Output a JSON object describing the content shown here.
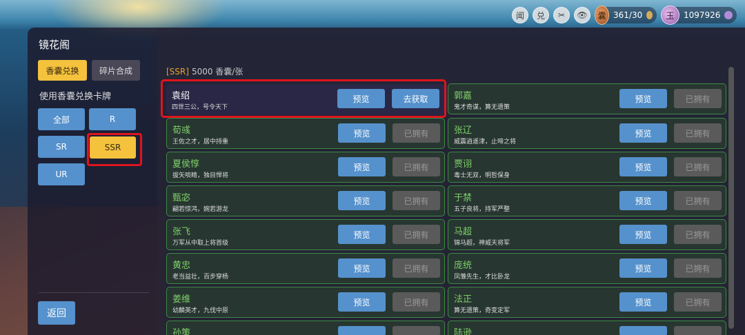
{
  "topbar": {
    "icons": [
      {
        "label": "闻",
        "name": "news-icon"
      },
      {
        "label": "兑",
        "name": "exchange-icon"
      },
      {
        "label": "✂",
        "name": "tool-icon"
      },
      {
        "label": "👁",
        "name": "eye-icon"
      }
    ],
    "currency_bag": "361/30",
    "currency_gem": "1097926"
  },
  "panel": {
    "title": "镜花阁",
    "tabs": [
      "香囊兑换",
      "碎片合成"
    ],
    "active_tab": "香囊兑换",
    "section_label": "使用香囊兑换卡牌",
    "filters": [
      "全部",
      "R",
      "SR",
      "SSR",
      "UR"
    ],
    "active_filter": "SSR",
    "back_label": "返回"
  },
  "content": {
    "rarity_tag": "[SSR]",
    "rarity_cost": "5000 香囊/张",
    "buttons": {
      "preview": "预览",
      "get": "去获取",
      "owned": "已拥有"
    },
    "left_cards": [
      {
        "name": "袁绍",
        "desc": "四世三公，号令天下",
        "status": "get"
      },
      {
        "name": "荀彧",
        "desc": "王佐之才，居中持重",
        "status": "owned"
      },
      {
        "name": "夏侯惇",
        "desc": "拔矢啖睛，独目悍将",
        "status": "owned"
      },
      {
        "name": "甄宓",
        "desc": "翩若惊鸿，婉若游龙",
        "status": "owned"
      },
      {
        "name": "张飞",
        "desc": "万军从中取上将首级",
        "status": "owned"
      },
      {
        "name": "黄忠",
        "desc": "老当益壮，百步穿杨",
        "status": "owned"
      },
      {
        "name": "姜维",
        "desc": "幼麟英才，九伐中原",
        "status": "owned"
      },
      {
        "name": "孙策",
        "desc": "",
        "status": "owned"
      }
    ],
    "right_cards": [
      {
        "name": "郭嘉",
        "desc": "鬼才奇谋，算无遗策",
        "status": "owned"
      },
      {
        "name": "张辽",
        "desc": "威震逍遥津，止啼之将",
        "status": "owned"
      },
      {
        "name": "贾诩",
        "desc": "毒士无双，明哲保身",
        "status": "owned"
      },
      {
        "name": "于禁",
        "desc": "五子良将，持军严整",
        "status": "owned"
      },
      {
        "name": "马超",
        "desc": "锦马超，神威天将军",
        "status": "owned"
      },
      {
        "name": "庞统",
        "desc": "凤雏先生，才比卧龙",
        "status": "owned"
      },
      {
        "name": "法正",
        "desc": "算无遗策，奇变定军",
        "status": "owned"
      },
      {
        "name": "陆逊",
        "desc": "",
        "status": "owned"
      }
    ]
  }
}
